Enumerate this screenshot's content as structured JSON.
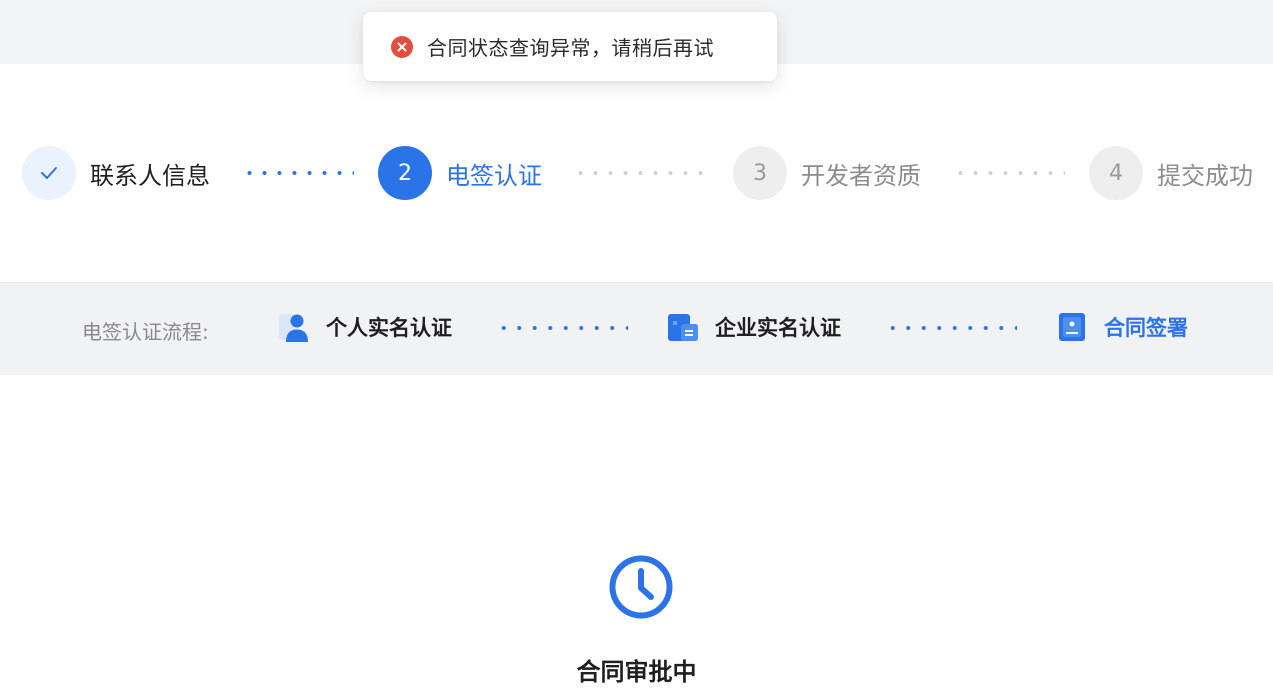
{
  "toast": {
    "message": "合同状态查询异常，请稍后再试",
    "icon": "error-circle-icon",
    "color": "#e34d3d"
  },
  "steps": [
    {
      "number": "",
      "label": "联系人信息",
      "state": "done",
      "icon": "check-icon"
    },
    {
      "number": "2",
      "label": "电签认证",
      "state": "active"
    },
    {
      "number": "3",
      "label": "开发者资质",
      "state": "pending"
    },
    {
      "number": "4",
      "label": "提交成功",
      "state": "pending"
    }
  ],
  "process": {
    "label": "电签认证流程:",
    "items": [
      {
        "label": "个人实名认证",
        "icon": "person-icon"
      },
      {
        "label": "企业实名认证",
        "icon": "building-icon"
      },
      {
        "label": "合同签署",
        "icon": "contract-icon"
      }
    ]
  },
  "status": {
    "text": "合同审批中",
    "icon": "clock-icon"
  },
  "colors": {
    "primary": "#2a74e8",
    "error": "#e34d3d",
    "muted": "#8c8c8c"
  }
}
